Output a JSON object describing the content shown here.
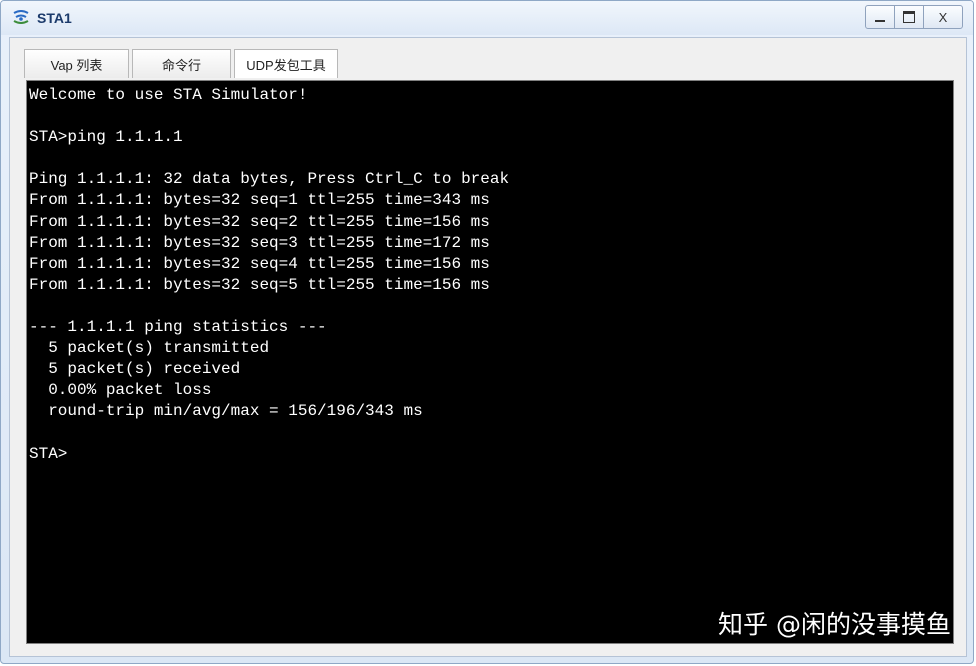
{
  "window": {
    "title": "STA1",
    "controls": {
      "minimize": "minimize-icon",
      "maximize": "maximize-icon",
      "close_label": "X"
    }
  },
  "tabs": [
    {
      "label": "Vap 列表"
    },
    {
      "label": "命令行"
    },
    {
      "label": "UDP发包工具"
    }
  ],
  "terminal": {
    "lines": [
      "Welcome to use STA Simulator!",
      "",
      "STA>ping 1.1.1.1",
      "",
      "Ping 1.1.1.1: 32 data bytes, Press Ctrl_C to break",
      "From 1.1.1.1: bytes=32 seq=1 ttl=255 time=343 ms",
      "From 1.1.1.1: bytes=32 seq=2 ttl=255 time=156 ms",
      "From 1.1.1.1: bytes=32 seq=3 ttl=255 time=172 ms",
      "From 1.1.1.1: bytes=32 seq=4 ttl=255 time=156 ms",
      "From 1.1.1.1: bytes=32 seq=5 ttl=255 time=156 ms",
      "",
      "--- 1.1.1.1 ping statistics ---",
      "  5 packet(s) transmitted",
      "  5 packet(s) received",
      "  0.00% packet loss",
      "  round-trip min/avg/max = 156/196/343 ms",
      "",
      "STA>"
    ],
    "watermark": "知乎 @闲的没事摸鱼"
  },
  "colors": {
    "terminal_bg": "#000000",
    "terminal_fg": "#ffffff",
    "title_text": "#1b3a6b"
  }
}
